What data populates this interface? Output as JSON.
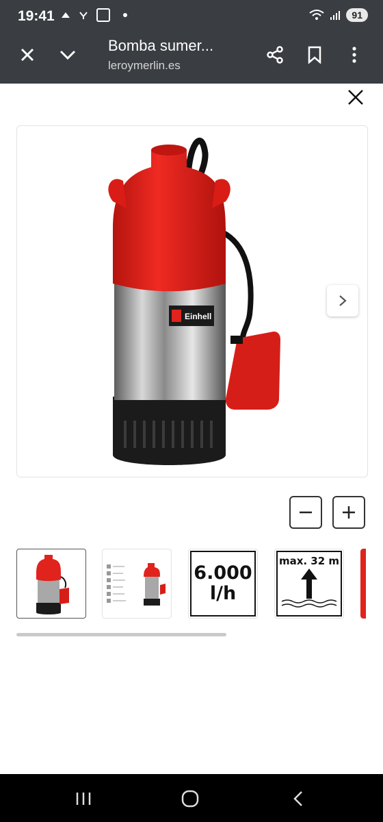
{
  "status_bar": {
    "time": "19:41",
    "left_icons": [
      "cast-icon",
      "network-icon",
      "notification-icon",
      "dot-icon"
    ],
    "battery": "91"
  },
  "app_bar": {
    "title": "Bomba sumer...",
    "url": "leroymerlin.es",
    "icons": [
      "close-icon",
      "chevron-down-icon",
      "share-icon",
      "bookmark-icon",
      "more-vert-icon"
    ]
  },
  "gallery": {
    "brand_label": "Einhell",
    "thumbnails": [
      {
        "type": "product-photo",
        "active": true
      },
      {
        "type": "product-with-features-list",
        "active": false
      },
      {
        "type": "spec-flow",
        "line1": "6.000",
        "line2": "l/h",
        "active": false
      },
      {
        "type": "spec-depth",
        "heading": "max. 32 m",
        "active": false
      },
      {
        "type": "partial",
        "active": false
      }
    ],
    "scroll_fraction": 0.6
  },
  "colors": {
    "app_bar_bg": "#3a3d42",
    "pump_red": "#e0231d",
    "nav_bg": "#000000"
  }
}
